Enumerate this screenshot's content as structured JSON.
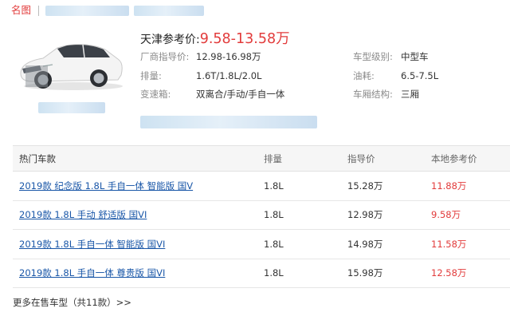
{
  "nav": {
    "logo": "名图"
  },
  "summary": {
    "price_label": "天津参考价:",
    "price_value": "9.58-13.58万"
  },
  "specs": [
    {
      "key": "厂商指导价:",
      "value": "12.98-16.98万"
    },
    {
      "key": "排量:",
      "value": "1.6T/1.8L/2.0L"
    },
    {
      "key": "变速箱:",
      "value": "双离合/手动/手自一体"
    },
    {
      "key": "车型级别:",
      "value": "中型车"
    },
    {
      "key": "油耗:",
      "value": "6.5-7.5L"
    },
    {
      "key": "车厢结构:",
      "value": "三厢"
    }
  ],
  "table": {
    "headers": [
      "热门车款",
      "排量",
      "指导价",
      "本地参考价"
    ],
    "rows": [
      [
        "2019款 纪念版 1.8L 手自一体 智能版 国V",
        "1.8L",
        "15.28万",
        "11.88万"
      ],
      [
        "2019款 1.8L 手动 舒适版 国VI",
        "1.8L",
        "12.98万",
        "9.58万"
      ],
      [
        "2019款 1.8L 手自一体 智能版 国VI",
        "1.8L",
        "14.98万",
        "11.58万"
      ],
      [
        "2019款 1.8L 手自一体 尊贵版 国VI",
        "1.8L",
        "15.98万",
        "12.58万"
      ]
    ]
  },
  "more_link": "更多在售车型（共11款）>>",
  "colors": {
    "accent_red": "#e23b3b",
    "link_blue": "#1a57a8",
    "label_gray": "#8a8a8a"
  }
}
